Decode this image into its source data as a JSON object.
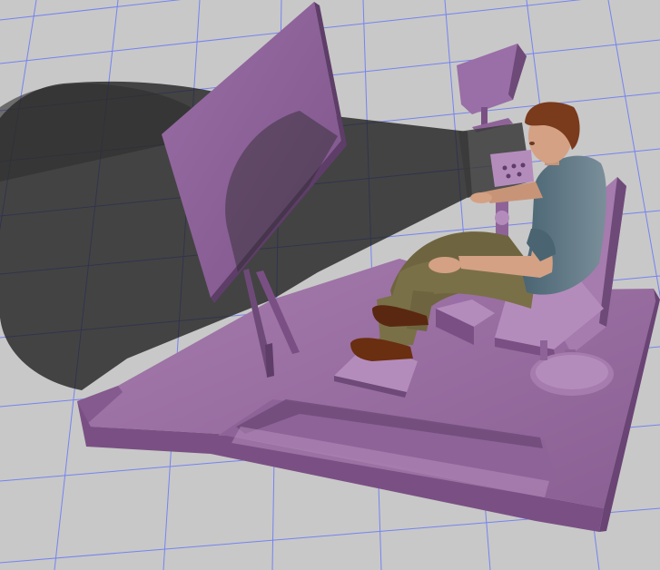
{
  "scene": {
    "background_color": "#c8c8c8",
    "grid_color": "#5a6cff",
    "shadow_color": "#1e1e1e",
    "platform_color": "#9e72a6",
    "platform_dark": "#6e4a78",
    "platform_light": "#b48cbc",
    "screen_color": "#8a6096",
    "shirt_color": "#56707e",
    "pants_color": "#7a7048",
    "skin_color": "#d4a184",
    "hair_color": "#7a3a1c",
    "shoe_color": "#6a2e10"
  }
}
